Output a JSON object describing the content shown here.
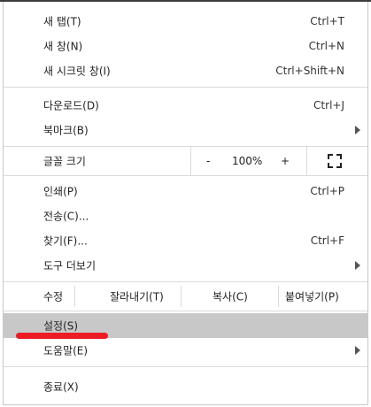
{
  "menu": {
    "new_tab": {
      "label": "새 탭(T)",
      "shortcut": "Ctrl+T"
    },
    "new_window": {
      "label": "새 창(N)",
      "shortcut": "Ctrl+N"
    },
    "new_incognito": {
      "label": "새 시크릿 창(I)",
      "shortcut": "Ctrl+Shift+N"
    },
    "downloads": {
      "label": "다운로드(D)",
      "shortcut": "Ctrl+J"
    },
    "bookmarks": {
      "label": "북마크(B)"
    },
    "zoom": {
      "label": "글꼴 크기",
      "minus": "-",
      "value": "100%",
      "plus": "+"
    },
    "print": {
      "label": "인쇄(P)",
      "shortcut": "Ctrl+P"
    },
    "cast": {
      "label": "전송(C)..."
    },
    "find": {
      "label": "찾기(F)...",
      "shortcut": "Ctrl+F"
    },
    "more_tools": {
      "label": "도구 더보기"
    },
    "edit": {
      "label": "수정",
      "cut": "잘라내기(T)",
      "copy": "복사(C)",
      "paste": "붙여넣기(P)"
    },
    "settings": {
      "label": "설정(S)"
    },
    "help": {
      "label": "도움말(E)"
    },
    "exit": {
      "label": "종료(X)"
    }
  },
  "icons": {
    "submenu_arrow": "chevron-right-icon",
    "fullscreen": "fullscreen-icon"
  },
  "colors": {
    "highlight": "#c8c8c8",
    "annotation": "#ec1c24"
  }
}
